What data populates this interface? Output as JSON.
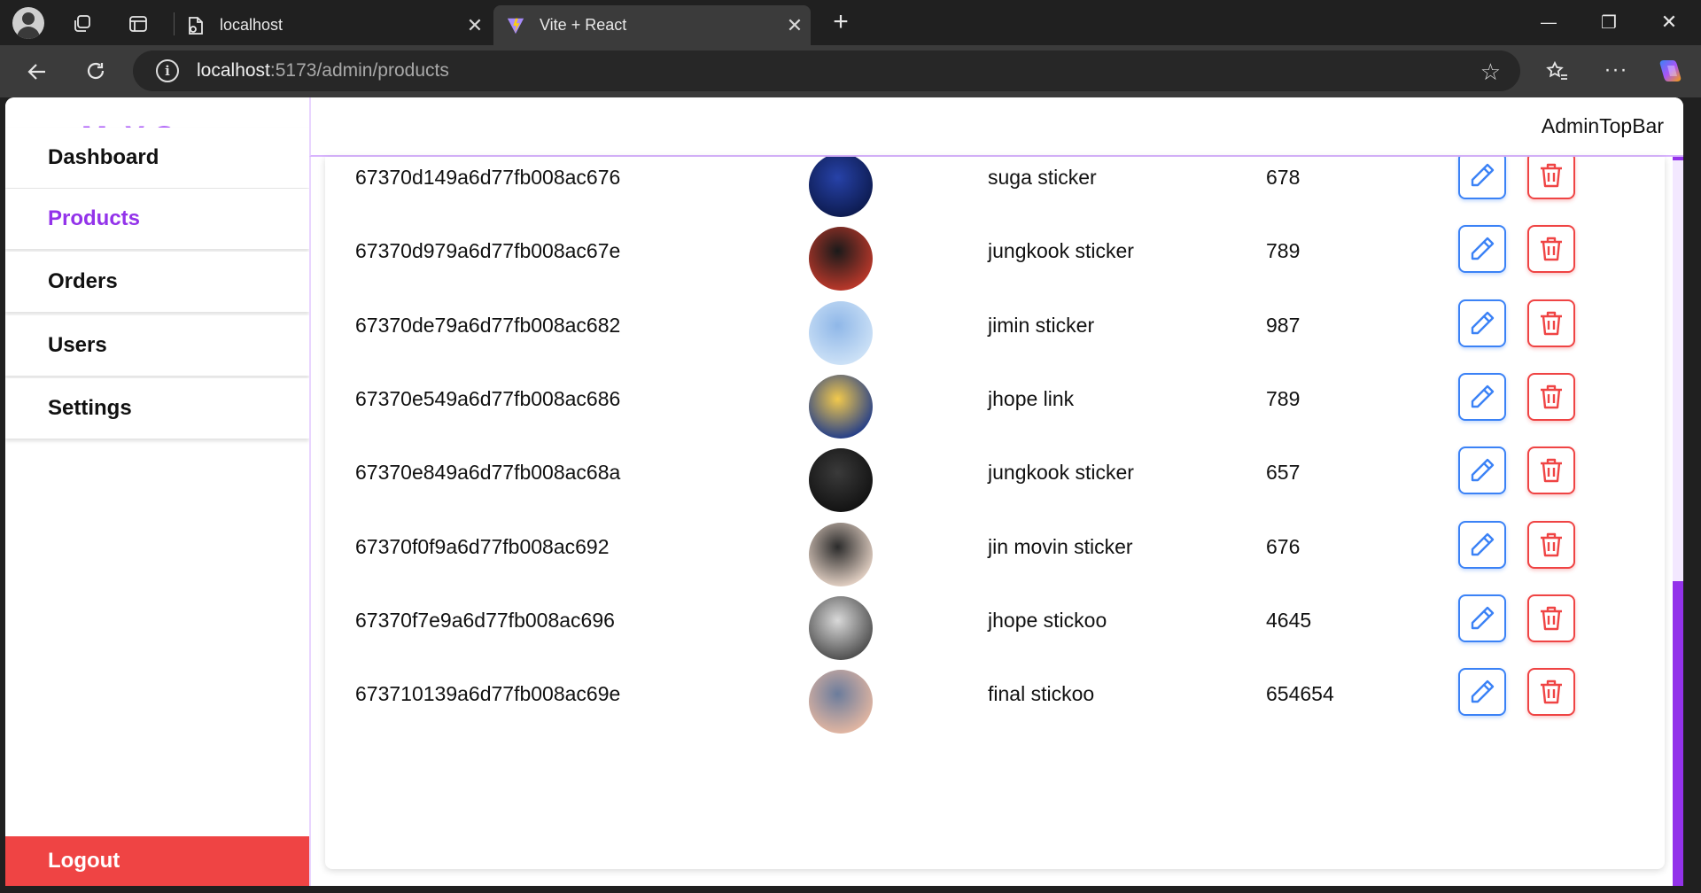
{
  "browser": {
    "tabs": [
      {
        "title": "localhost",
        "close": "✕"
      },
      {
        "title": "Vite + React",
        "close": "✕"
      }
    ],
    "new_tab": "+",
    "window": {
      "minimize": "—",
      "restore": "❐",
      "close": "✕"
    },
    "address": {
      "host": "localhost",
      "path": ":5173/admin/products"
    },
    "more_label": "···"
  },
  "sidebar": {
    "brand": "MaX Store",
    "items": [
      {
        "label": "Dashboard"
      },
      {
        "label": "Products",
        "active": true
      },
      {
        "label": "Orders"
      },
      {
        "label": "Users"
      },
      {
        "label": "Settings"
      }
    ],
    "logout": "Logout"
  },
  "topbar": {
    "title": "AdminTopBar"
  },
  "products": [
    {
      "id": "67370d149a6d77fb008ac676",
      "name": "suga sticker",
      "price": "678",
      "avatar_colors": [
        "#0c1a4d",
        "#2742a8"
      ]
    },
    {
      "id": "67370d979a6d77fb008ac67e",
      "name": "jungkook sticker",
      "price": "789",
      "avatar_colors": [
        "#c0392b",
        "#1a1a1a"
      ]
    },
    {
      "id": "67370de79a6d77fb008ac682",
      "name": "jimin sticker",
      "price": "987",
      "avatar_colors": [
        "#cfe3f7",
        "#8fb7e8"
      ]
    },
    {
      "id": "67370e549a6d77fb008ac686",
      "name": "jhope link",
      "price": "789",
      "avatar_colors": [
        "#1e3a8a",
        "#f2c94c"
      ]
    },
    {
      "id": "67370e849a6d77fb008ac68a",
      "name": "jungkook sticker",
      "price": "657",
      "avatar_colors": [
        "#111111",
        "#3a3a3a"
      ]
    },
    {
      "id": "67370f0f9a6d77fb008ac692",
      "name": "jin movin sticker",
      "price": "676",
      "avatar_colors": [
        "#e8d5c8",
        "#2b2b2b"
      ]
    },
    {
      "id": "67370f7e9a6d77fb008ac696",
      "name": "jhope stickoo",
      "price": "4645",
      "avatar_colors": [
        "#4a4a4a",
        "#d9d9d9"
      ]
    },
    {
      "id": "673710139a6d77fb008ac69e",
      "name": "final stickoo",
      "price": "654654",
      "avatar_colors": [
        "#e6b8a2",
        "#6b7c9c"
      ]
    }
  ],
  "colors": {
    "accent": "#9333ea",
    "brand": "#a855f7",
    "edit": "#3b82f6",
    "delete": "#ef4444"
  }
}
